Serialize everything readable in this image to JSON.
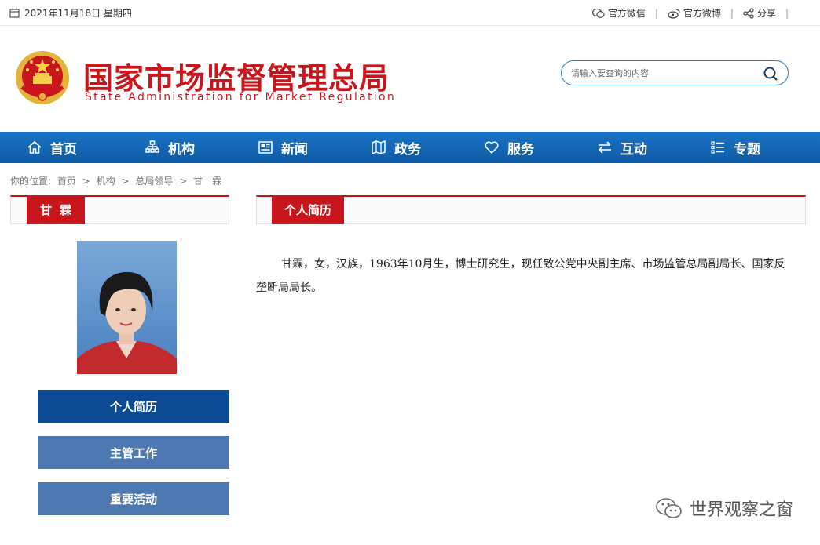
{
  "topbar": {
    "date": "2021年11月18日 星期四",
    "wechat": "官方微信",
    "weibo": "官方微博",
    "share": "分享",
    "separator": "|"
  },
  "header": {
    "title_cn": "国家市场监督管理总局",
    "title_en": "State Administration for Market Regulation",
    "search_placeholder": "请输入要查询的内容"
  },
  "nav": [
    {
      "label": "首页",
      "icon": "home-icon"
    },
    {
      "label": "机构",
      "icon": "org-chart-icon"
    },
    {
      "label": "新闻",
      "icon": "newspaper-icon"
    },
    {
      "label": "政务",
      "icon": "map-book-icon"
    },
    {
      "label": "服务",
      "icon": "heart-icon"
    },
    {
      "label": "互动",
      "icon": "swap-arrows-icon"
    },
    {
      "label": "专题",
      "icon": "list-icon"
    }
  ],
  "breadcrumb": {
    "prefix": "你的位置:",
    "items": [
      "首页",
      "机构",
      "总局领导",
      "甘　霖"
    ],
    "sep": ">"
  },
  "left": {
    "name_tab": "甘霖",
    "buttons": [
      "个人简历",
      "主管工作",
      "重要活动"
    ]
  },
  "right": {
    "tab": "个人简历",
    "bio": "甘霖，女，汉族，1963年10月生，博士研究生，现任致公党中央副主席、市场监管总局副局长、国家反垄断局局长。"
  },
  "watermark": "世界观察之窗",
  "colors": {
    "brand_red": "#c8161d",
    "nav_blue": "#0d5aa5",
    "button_dark": "#0c4b94",
    "button_light": "#4d78b2"
  }
}
